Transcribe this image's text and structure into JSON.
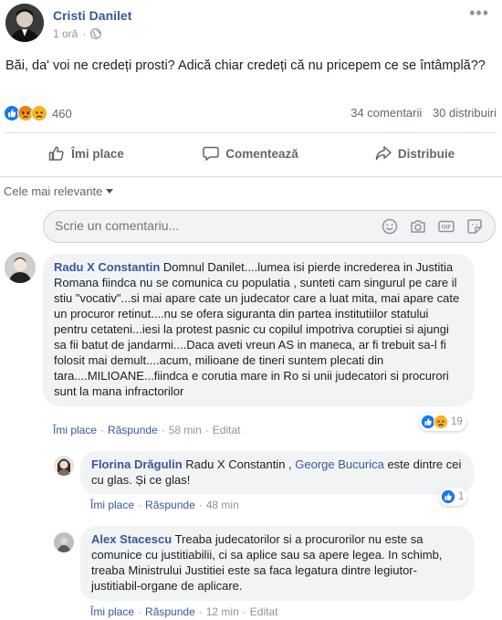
{
  "post": {
    "author": "Cristi Danilet",
    "time": "1 oră",
    "dot": "·",
    "text": "Băi, da' voi ne credeți prosti? Adică chiar credeți că nu pricepem ce se întâmplă??",
    "reaction_count": "460",
    "comments_count": "34 comentarii",
    "shares_count": "30 distribuiri",
    "more_label": "•••"
  },
  "actions": {
    "like": "Îmi place",
    "comment": "Comentează",
    "share": "Distribuie"
  },
  "sort": {
    "label": "Cele mai relevante"
  },
  "composer": {
    "placeholder": "Scrie un comentariu..."
  },
  "comments": [
    {
      "author": "Radu X Constantin",
      "text": "Domnul Danilet....lumea isi pierde increderea in Justitia Romana fiindca nu se comunica cu populatia , sunteti cam singurul pe care il stiu \"vocativ\"...si mai apare cate un judecator care a luat mita, mai apare cate un procuror retinut....nu se ofera siguranta din partea institutiilor statului pentru cetateni...iesi la protest pasnic cu copilul impotriva coruptiei si ajungi sa fii batut de jandarmi....Daca aveti vreun AS in maneca, ar fi trebuit sa-l fi folosit mai demult....acum, milioane de tineri suntem plecati din tara....MILIOANE...fiindca e corutia mare in Ro si unii judecatori si procurori sunt la mana infractorilor",
      "like": "Îmi place",
      "reply": "Răspunde",
      "time": "58 min",
      "edited": "Editat",
      "reactions": "19"
    },
    {
      "author": "Florina Drăgulin",
      "mention1": "Radu X Constantin",
      "sep": " , ",
      "mention2": "George Bucurica",
      "text": " este dintre cei cu glas. Și ce glas!",
      "like": "Îmi place",
      "reply": "Răspunde",
      "time": "48 min",
      "reactions": "1"
    },
    {
      "author": "Alex Stacescu",
      "text": "Treaba judecatorilor si a procurorilor nu este sa comunice cu justitiabilii, ci sa aplice sau sa apere legea. In schimb, treaba Ministrului Justitiei este sa faca legatura dintre legiutor-justitiabil-organe de aplicare.",
      "like": "Îmi place",
      "reply": "Răspunde",
      "time": "12 min",
      "edited": "Editat"
    }
  ],
  "colors": {
    "link": "#385898",
    "muted": "#90949c",
    "bubble": "#f2f3f5",
    "like_blue": "#1877f2",
    "angry": "#e9710f",
    "sad": "#f7b125"
  }
}
